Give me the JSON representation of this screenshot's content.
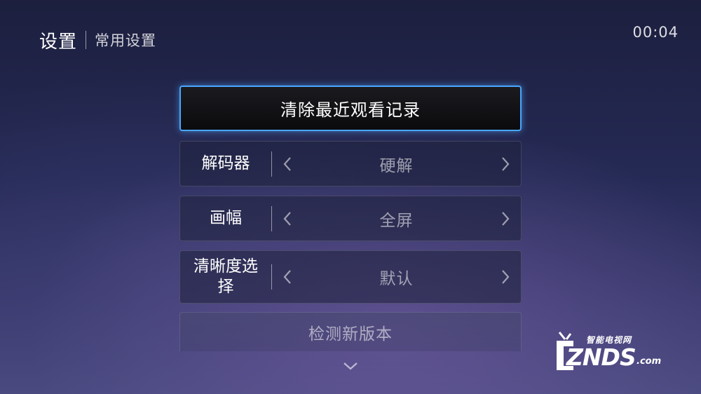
{
  "header": {
    "title": "设置",
    "subtitle": "常用设置"
  },
  "clock": "00:04",
  "menu": {
    "clear_history": "清除最近观看记录",
    "rows": [
      {
        "label": "解码器",
        "value": "硬解"
      },
      {
        "label": "画幅",
        "value": "全屏"
      },
      {
        "label": "清晰度选择",
        "value": "默认"
      }
    ],
    "check_update": "检测新版本"
  },
  "watermark": {
    "tagline": "智能电视网",
    "brand": "ZNDS",
    "domain": ".com"
  },
  "colors": {
    "focus_border": "#4aa6ff",
    "background_top": "#1c1f3e",
    "background_bottom": "#4a4a80"
  },
  "icons": {
    "left": "chevron-left-icon",
    "right": "chevron-right-icon",
    "scroll": "chevron-down-icon"
  }
}
